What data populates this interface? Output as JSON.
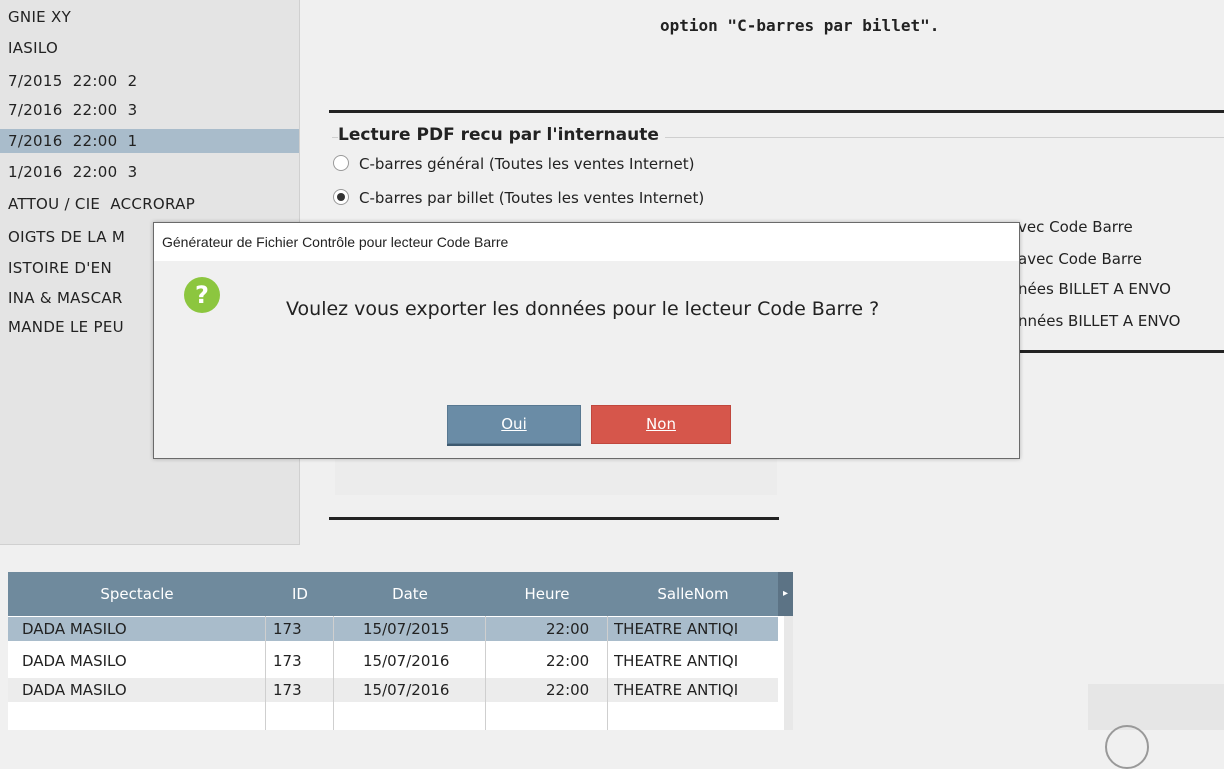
{
  "left_list": {
    "rows": [
      "GNIE XY",
      "IASILO",
      "7/2015  22:00  2",
      "7/2016  22:00  3",
      "7/2016  22:00  1",
      "1/2016  22:00  3",
      "ATTOU / CIE  ACCRORAP",
      "OIGTS DE LA M",
      "ISTOIRE D'EN",
      "INA & MASCAR",
      "MANDE LE PEU"
    ]
  },
  "top_note": "option \"C-barres par billet\".",
  "pdf_section": {
    "legend": "Lecture PDF recu par l'internaute",
    "options": [
      {
        "label": "C-barres général (Toutes les ventes Internet)",
        "checked": false
      },
      {
        "label": "C-barres par billet (Toutes les ventes Internet)",
        "checked": true
      }
    ]
  },
  "right_texts": [
    "vec Code Barre",
    "avec Code Barre",
    "nées BILLET A ENVO",
    "nnées BILLET A ENVO"
  ],
  "table": {
    "columns": [
      "Spectacle",
      "ID",
      "Date",
      "Heure",
      "SalleNom"
    ],
    "rows": [
      [
        "DADA MASILO",
        "173",
        "15/07/2015",
        "22:00",
        "THEATRE ANTIQI"
      ],
      [
        "DADA MASILO",
        "173",
        "15/07/2016",
        "22:00",
        "THEATRE ANTIQI"
      ],
      [
        "DADA MASILO",
        "173",
        "15/07/2016",
        "22:00",
        "THEATRE ANTIQI"
      ]
    ],
    "selected_row": 0
  },
  "dialog": {
    "title": "Générateur de Fichier Contrôle pour lecteur Code Barre",
    "message": "Voulez vous exporter les données pour le lecteur Code Barre ?",
    "icon": "question-icon",
    "buttons": {
      "yes": "Oui",
      "no": "Non"
    }
  },
  "colors": {
    "header": "#6f8a9d",
    "selected": "#a9bccb",
    "yes_button": "#6a8ca6",
    "no_button": "#d6564b",
    "icon": "#8cc63f"
  }
}
